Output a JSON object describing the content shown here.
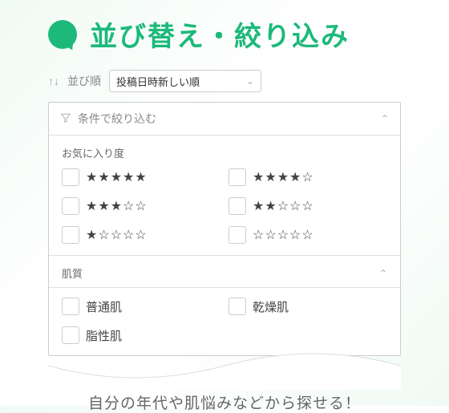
{
  "header": {
    "title": "並び替え・絞り込み"
  },
  "sort": {
    "label": "並び順",
    "selected": "投稿日時新しい順"
  },
  "filter": {
    "title": "条件で絞り込む",
    "sections": {
      "favorite": {
        "title": "お気に入り度",
        "options": [
          "★★★★★",
          "★★★★☆",
          "★★★☆☆",
          "★★☆☆☆",
          "★☆☆☆☆",
          "☆☆☆☆☆"
        ]
      },
      "skin": {
        "title": "肌質",
        "options": [
          "普通肌",
          "乾燥肌",
          "脂性肌"
        ]
      }
    }
  },
  "footer": {
    "text": "自分の年代や肌悩みなどから探せる！"
  }
}
